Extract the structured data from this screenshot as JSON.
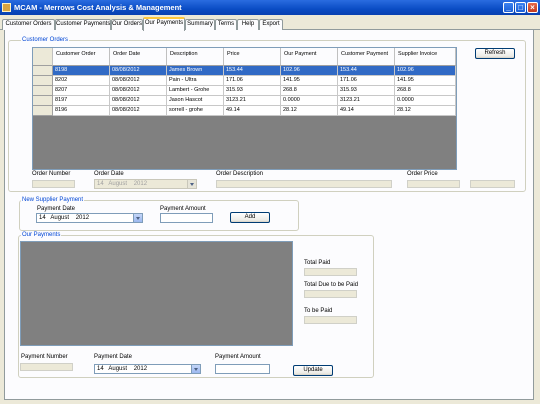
{
  "window": {
    "title": "MCAM - Merrows Cost Analysis & Management"
  },
  "tabs": [
    {
      "label": "Customer Orders"
    },
    {
      "label": "Customer Payments"
    },
    {
      "label": "Our Orders"
    },
    {
      "label": "Our Payments"
    },
    {
      "label": "Summary"
    },
    {
      "label": "Terms"
    },
    {
      "label": "Help"
    },
    {
      "label": "Export"
    }
  ],
  "active_tab": "Our Payments",
  "customer_orders": {
    "group_label": "Customer Orders",
    "refresh_label": "Refresh",
    "columns": [
      "Customer Order",
      "Order Date",
      "Description",
      "Price",
      "Our Payment",
      "Customer Payment",
      "Supplier Invoice"
    ],
    "rows": [
      [
        "8198",
        "08/08/2012",
        "James Brown",
        "153.44",
        "102.96",
        "153.44",
        "102.96"
      ],
      [
        "8202",
        "08/08/2012",
        "Pain - Ultra",
        "171.06",
        "141.95",
        "171.06",
        "141.95"
      ],
      [
        "8207",
        "08/08/2012",
        "Lambert - Grohe",
        "315.93",
        "268.8",
        "315.93",
        "268.8"
      ],
      [
        "8197",
        "08/08/2012",
        "Jason Hascot",
        "3123.21",
        "0.0000",
        "3123.21",
        "0.0000"
      ],
      [
        "8196",
        "08/08/2012",
        "sorrell - grohe",
        "49.14",
        "28.12",
        "49.14",
        "28.12"
      ]
    ],
    "selected_row": 0,
    "labels": {
      "order_number": "Order Number",
      "order_date": "Order Date",
      "order_description": "Order Description",
      "order_price": "Order Price"
    },
    "order_date_value": {
      "day": "14",
      "month": "August",
      "year": "2012"
    }
  },
  "new_supplier_payment": {
    "group_label": "New Supplier Payment",
    "payment_date_label": "Payment Date",
    "payment_date_value": {
      "day": "14",
      "month": "August",
      "year": "2012"
    },
    "payment_amount_label": "Payment Amount",
    "payment_amount_value": "",
    "add_label": "Add"
  },
  "our_payments": {
    "group_label": "Our Payments",
    "total_paid_label": "Total Paid",
    "total_due_label": "Total Due to be Paid",
    "to_be_paid_label": "To be Paid",
    "payment_number_label": "Payment Number",
    "payment_date_label": "Payment Date",
    "payment_date_value": {
      "day": "14",
      "month": "August",
      "year": "2012"
    },
    "payment_amount_label": "Payment Amount",
    "update_label": "Update"
  }
}
